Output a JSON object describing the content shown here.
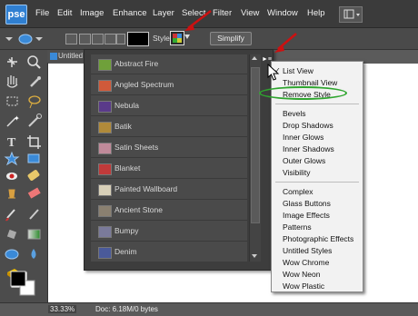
{
  "app": {
    "logo": "pse"
  },
  "menubar": {
    "items": [
      "File",
      "Edit",
      "Image",
      "Enhance",
      "Layer",
      "Select",
      "Filter",
      "View",
      "Window",
      "Help"
    ]
  },
  "options": {
    "style_label": "Style:",
    "simplify": "Simplify"
  },
  "document": {
    "tab_title": "Untitled"
  },
  "status": {
    "zoom": "33.33%",
    "doc": "Doc: 6.18M/0 bytes"
  },
  "styles_panel": {
    "items": [
      {
        "label": "Abstract Fire",
        "color": "#6fa03a"
      },
      {
        "label": "Angled Spectrum",
        "color": "#d05a3a"
      },
      {
        "label": "Nebula",
        "color": "#5a3a8a"
      },
      {
        "label": "Batik",
        "color": "#b08a3a"
      },
      {
        "label": "Satin Sheets",
        "color": "#c08a9a"
      },
      {
        "label": "Blanket",
        "color": "#c03a3a"
      },
      {
        "label": "Painted Wallboard",
        "color": "#d8d0b8"
      },
      {
        "label": "Ancient Stone",
        "color": "#8a8070"
      },
      {
        "label": "Bumpy",
        "color": "#7a7a9a"
      },
      {
        "label": "Denim",
        "color": "#4a5a9a"
      }
    ]
  },
  "flyout": {
    "group1": [
      "List View",
      "Thumbnail View",
      "Remove Style"
    ],
    "group2": [
      "Bevels",
      "Drop Shadows",
      "Inner Glows",
      "Inner Shadows",
      "Outer Glows",
      "Visibility"
    ],
    "group3": [
      "Complex",
      "Glass Buttons",
      "Image Effects",
      "Patterns",
      "Photographic Effects",
      "Untitled Styles",
      "Wow Chrome",
      "Wow Neon",
      "Wow Plastic"
    ],
    "checked": "List View"
  },
  "colors": {
    "annotation_arrow": "#cc1111",
    "highlight_oval": "#2fa52f"
  }
}
